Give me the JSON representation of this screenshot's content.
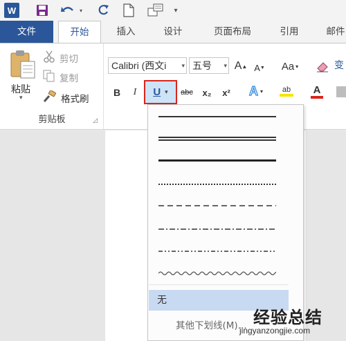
{
  "quick_access": {
    "word_logo": "W",
    "icons": [
      "save-icon",
      "undo-icon",
      "redo-icon",
      "new-document-icon",
      "touch-mode-icon",
      "customize-icon"
    ]
  },
  "tabs": [
    "文件",
    "开始",
    "插入",
    "设计",
    "页面布局",
    "引用",
    "邮件"
  ],
  "clipboard": {
    "paste": "粘贴",
    "cut": "剪切",
    "copy": "复制",
    "format_painter": "格式刷",
    "group_label": "剪贴板"
  },
  "font": {
    "font_name": "Calibri (西文i",
    "font_size": "五号",
    "grow": "A",
    "shrink": "A",
    "change_case": "Aa",
    "bold": "B",
    "italic": "I",
    "underline": "U",
    "strikethrough": "abc",
    "subscript": "x₂",
    "superscript": "x²",
    "effects": "A",
    "highlight": "ab",
    "font_color": "A",
    "font_color_value": "#d9251c",
    "highlight_color_value": "#f5e400",
    "extra": "变"
  },
  "underline_menu": {
    "styles": [
      "single",
      "double",
      "thick",
      "dotted",
      "dashed",
      "dash-dot",
      "dash-dot-dot",
      "wave"
    ],
    "none": "无",
    "more": "其他下划线(M)..."
  },
  "watermark": {
    "title": "经验总结",
    "url": "jingyanzongjie.com"
  },
  "colors": {
    "accent": "#2b579a",
    "highlight_box": "#d9251c",
    "selected_bg": "#c8daf1"
  }
}
